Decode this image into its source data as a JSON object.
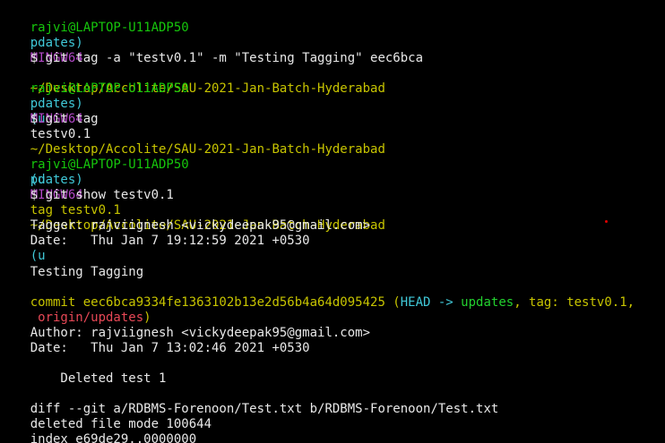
{
  "prompt": {
    "user_host": "rajvi@LAPTOP-U11ADP50",
    "shell": "MINGW64",
    "path": "~/Desktop/Accolite/SAU-2021-Jan-Batch-Hyderabad",
    "branch_open": "(u",
    "branch_rest": "pdates)"
  },
  "commands": {
    "c1": "$ git tag -a \"testv0.1\" -m \"Testing Tagging\" eec6bca",
    "c2": "$ git tag",
    "c3": "$ git show testv0.1"
  },
  "outputs": {
    "tag_list": "testv0.1",
    "tag_header": "tag testv0.1",
    "tagger": "Tagger: rajviignesh <vickydeepak95@gmail.com>",
    "tag_date": "Date:   Thu Jan 7 19:12:59 2021 +0530",
    "tag_message": "Testing Tagging",
    "commit_prefix": "commit eec6bca9334fe1363102b13e2d56b4a64d095425",
    "commit_paren_open": " (",
    "head": "HEAD -> ",
    "head_branch": "updates",
    "sep1": ", ",
    "tag_ref": "tag: testv0.1",
    "sep2": ",",
    "origin": " origin/updates",
    "commit_paren_close": ")",
    "author": "Author: rajviignesh <vickydeepak95@gmail.com>",
    "commit_date": "Date:   Thu Jan 7 13:02:46 2021 +0530",
    "commit_message": "    Deleted test 1",
    "diff_header": "diff --git a/RDBMS-Forenoon/Test.txt b/RDBMS-Forenoon/Test.txt",
    "deleted_mode": "deleted file mode 100644",
    "index_line": "index e69de29..0000000"
  },
  "colors": {
    "background": "#000000",
    "prompt_user": "#16c60c",
    "prompt_shell": "#b148c6",
    "prompt_path": "#c7c400",
    "branch": "#40c8d8",
    "tag_header": "#c7c400",
    "head_label": "#40c8d8",
    "branch_label": "#23d12f",
    "origin_label": "#e74856",
    "text": "#e8e8e8",
    "stray_dot": "#e00000"
  }
}
